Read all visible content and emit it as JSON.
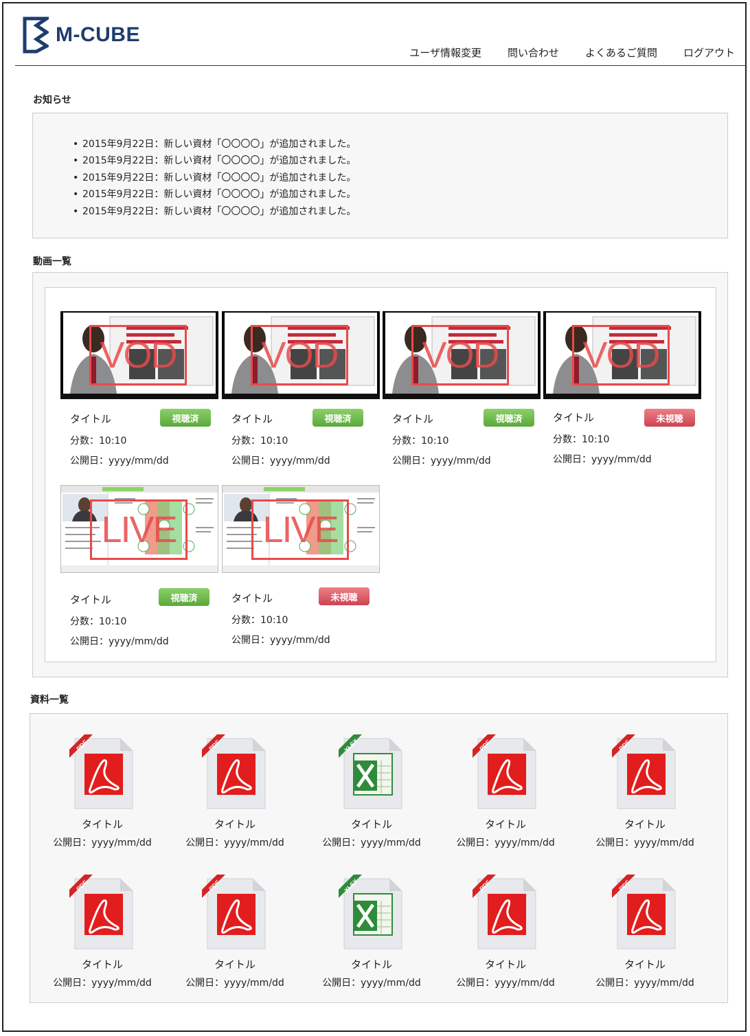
{
  "header": {
    "logo_text": "M-CUBE",
    "nav": [
      "ユーザ情報変更",
      "問い合わせ",
      "よくあるご質問",
      "ログアウト"
    ]
  },
  "notices": {
    "title": "お知らせ",
    "items": [
      "2015年9月22日：新しい資材「〇〇〇〇」が追加されました。",
      "2015年9月22日：新しい資材「〇〇〇〇」が追加されました。",
      "2015年9月22日：新しい資材「〇〇〇〇」が追加されました。",
      "2015年9月22日：新しい資材「〇〇〇〇」が追加されました。",
      "2015年9月22日：新しい資材「〇〇〇〇」が追加されました。"
    ]
  },
  "videos": {
    "title": "動画一覧",
    "items": [
      {
        "type": "VOD",
        "title": "タイトル",
        "status": "視聴済",
        "duration": "分数：10:10",
        "date": "公開日：yyyy/mm/dd"
      },
      {
        "type": "VOD",
        "title": "タイトル",
        "status": "視聴済",
        "duration": "分数：10:10",
        "date": "公開日：yyyy/mm/dd"
      },
      {
        "type": "VOD",
        "title": "タイトル",
        "status": "視聴済",
        "duration": "分数：10:10",
        "date": "公開日：yyyy/mm/dd"
      },
      {
        "type": "VOD",
        "title": "タイトル",
        "status": "未視聴",
        "duration": "分数：10:10",
        "date": "公開日：yyyy/mm/dd"
      },
      {
        "type": "LIVE",
        "title": "タイトル",
        "status": "視聴済",
        "duration": "分数：10:10",
        "date": "公開日：yyyy/mm/dd"
      },
      {
        "type": "LIVE",
        "title": "タイトル",
        "status": "未視聴",
        "duration": "分数：10:10",
        "date": "公開日：yyyy/mm/dd"
      }
    ]
  },
  "documents": {
    "title": "資料一覧",
    "items": [
      {
        "type": "PDF",
        "title": "タイトル",
        "date": "公開日：yyyy/mm/dd"
      },
      {
        "type": "PDF",
        "title": "タイトル",
        "date": "公開日：yyyy/mm/dd"
      },
      {
        "type": "XLSX",
        "title": "タイトル",
        "date": "公開日：yyyy/mm/dd"
      },
      {
        "type": "PDF",
        "title": "タイトル",
        "date": "公開日：yyyy/mm/dd"
      },
      {
        "type": "PDF",
        "title": "タイトル",
        "date": "公開日：yyyy/mm/dd"
      },
      {
        "type": "PDF",
        "title": "タイトル",
        "date": "公開日：yyyy/mm/dd"
      },
      {
        "type": "PDF",
        "title": "タイトル",
        "date": "公開日：yyyy/mm/dd"
      },
      {
        "type": "XLSX",
        "title": "タイトル",
        "date": "公開日：yyyy/mm/dd"
      },
      {
        "type": "PDF",
        "title": "タイトル",
        "date": "公開日：yyyy/mm/dd"
      },
      {
        "type": "PDF",
        "title": "タイトル",
        "date": "公開日：yyyy/mm/dd"
      }
    ]
  },
  "colors": {
    "brand": "#1e3c6e",
    "watched": "#6cba48",
    "unwatched": "#d9535f",
    "pdf": "#e02020",
    "excel": "#2e8b3a"
  }
}
